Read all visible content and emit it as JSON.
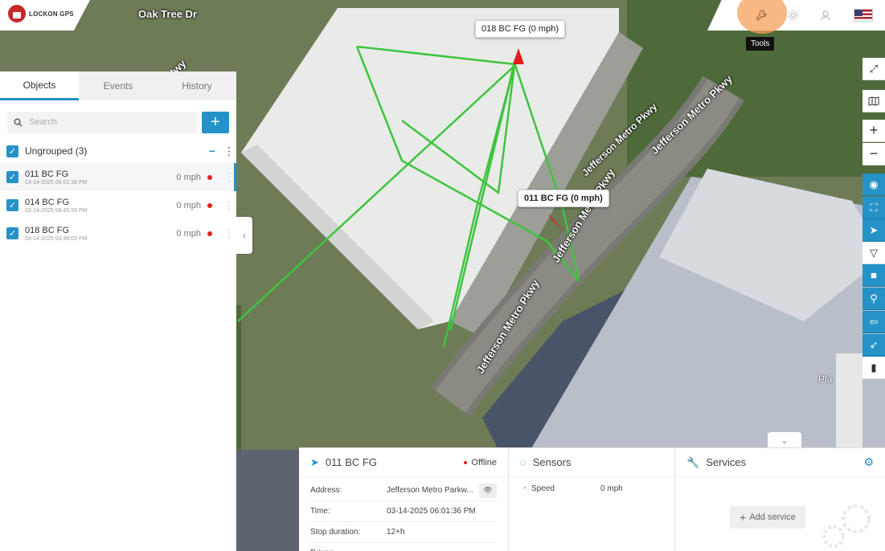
{
  "topbar": {
    "logo_text": "LOCKON GPS",
    "tools_tooltip": "Tools",
    "icons": [
      "wrench-icon",
      "gear-icon",
      "user-icon",
      "us-flag-icon"
    ]
  },
  "map": {
    "road_labels": [
      "Oak Tree Dr",
      "Hwy",
      "Jefferson Metro Pkwy",
      "Jefferson Metro Pkwy",
      "Jefferson Metro Pkwy",
      "Jefferson Metro Pkwy"
    ],
    "place_label": "Pla",
    "vehicle_tooltips": [
      "018 BC FG (0 mph)",
      "011 BC FG (0 mph)"
    ],
    "route_color": "#3ec43e",
    "marker_color": "#e01e1e"
  },
  "left_panel": {
    "tabs": [
      "Objects",
      "Events",
      "History"
    ],
    "active_tab": "Objects",
    "search_placeholder": "Search",
    "add_button": "+",
    "group": {
      "name": "Ungrouped (3)",
      "collapse": "−"
    },
    "objects": [
      {
        "name": "011 BC FG",
        "time": "03-14-2025 06:01:36 PM",
        "speed": "0 mph"
      },
      {
        "name": "014 BC FG",
        "time": "03-14-2025 08:45:59 PM",
        "speed": "0 mph"
      },
      {
        "name": "018 BC FG",
        "time": "03-14-2025 03:49:03 PM",
        "speed": "0 mph"
      }
    ]
  },
  "right_toolbar": [
    "fullscreen-icon",
    "map-layers-icon",
    "zoom-in-icon",
    "zoom-out-icon",
    "target-icon",
    "fit-bounds-icon",
    "navigate-icon",
    "filter-icon",
    "lock-icon",
    "location-pin-icon",
    "back-arrow-icon",
    "send-icon",
    "traffic-light-icon"
  ],
  "details": {
    "title": "011 BC FG",
    "status": "Offline",
    "rows": [
      {
        "key": "Address:",
        "value": "Jefferson Metro Parkw..."
      },
      {
        "key": "Time:",
        "value": "03-14-2025 06:01:36 PM"
      },
      {
        "key": "Stop duration:",
        "value": "12+h"
      },
      {
        "key": "Driver:",
        "value": ""
      }
    ]
  },
  "sensors": {
    "title": "Sensors",
    "rows": [
      {
        "name": "Speed",
        "value": "0 mph"
      }
    ]
  },
  "services": {
    "title": "Services",
    "add_label": "Add service"
  }
}
